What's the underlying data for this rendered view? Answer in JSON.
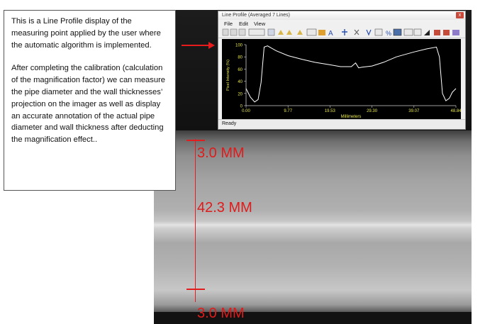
{
  "note": {
    "paragraph1": "This is a Line Profile display of the measuring point applied by the user where the automatic algorithm is implemented.",
    "paragraph2": "After completing the calibration (calculation of the magnification factor) we can measure the pipe diameter and the wall thicknesses’ projection on the imager as well as display an accurate annotation of the actual pipe diameter and wall thickness after deducting the magnification effect.."
  },
  "window": {
    "title": "Line Profile (Averaged 7 Lines)",
    "close_glyph": "x",
    "menu": [
      "File",
      "Edit",
      "View"
    ],
    "status": "Ready",
    "toolbar_icons": [
      "copy-icon",
      "save-icon",
      "print-icon",
      "zoom-icon",
      "smooth-icon",
      "filter-icon",
      "filter2-icon",
      "grid-icon",
      "fill-icon",
      "line-icon",
      "text-icon",
      "marker-icon",
      "delete-icon",
      "cursor-icon",
      "average-icon",
      "percent-icon",
      "display-icon",
      "max-icon",
      "min-icon",
      "slope-icon",
      "export-icon",
      "settings-icon"
    ]
  },
  "annotations": {
    "top_wall": "3.0 MM",
    "diameter": "42.3 MM",
    "bottom_wall": "3.0 MM"
  },
  "colors": {
    "annotation": "#e01b1b",
    "plot_background": "#000000",
    "trace": "#ffffff",
    "tick_labels": "#e8e84a"
  },
  "chart_data": {
    "type": "line",
    "title": "",
    "xlabel": "Millimeters",
    "ylabel": "Pixel Intensity (%)",
    "xlim": [
      0,
      48.84
    ],
    "ylim": [
      0,
      100
    ],
    "x_ticks": [
      "0.00",
      "9.77",
      "19.53",
      "29.30",
      "39.07",
      "48.84"
    ],
    "y_ticks": [
      "0",
      "20",
      "40",
      "60",
      "80",
      "100"
    ],
    "series": [
      {
        "x": [
          0,
          1,
          2,
          2.8,
          3.5,
          4.2,
          5,
          7,
          9.77,
          13,
          16,
          19.53,
          22,
          24.5,
          25.5,
          26.2,
          27,
          29.3,
          32,
          35,
          39.07,
          42,
          44.3,
          45,
          45.7,
          46.5,
          47.3,
          48,
          48.84
        ],
        "values": [
          28,
          14,
          6,
          10,
          38,
          96,
          98,
          90,
          82,
          76,
          71,
          67,
          64,
          64,
          70,
          62,
          63,
          65,
          71,
          80,
          88,
          93,
          96,
          80,
          20,
          8,
          12,
          22,
          28
        ]
      }
    ]
  }
}
